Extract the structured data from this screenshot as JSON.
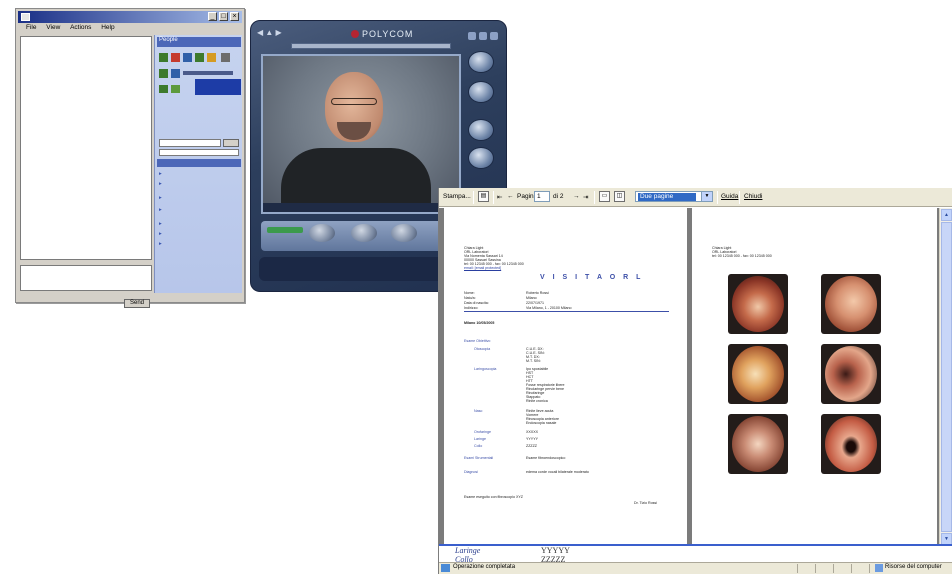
{
  "messenger": {
    "title": "",
    "menu": [
      "File",
      "View",
      "Actions",
      "Help"
    ],
    "panel_header": "People",
    "send_label": "Send",
    "status_text": "",
    "tasks": [
      "",
      "",
      "",
      "",
      "",
      "",
      ""
    ]
  },
  "polycom": {
    "brand": "POLYCOM",
    "caption": "",
    "right_labels": [
      "",
      "",
      "",
      "",
      ""
    ],
    "bottom_labels": [
      "",
      "",
      ""
    ]
  },
  "toolbar": {
    "print_label": "Stampa...",
    "page_label": "Pagina",
    "page_value": "1",
    "page_of": "di 2",
    "zoom_value": "Due pagine",
    "help_label": "Guida",
    "close_label": "Chiudi"
  },
  "page1": {
    "header_lines": [
      "Chiara Light",
      "ORL Laboratori",
      "Via Nomenta Sassari 14",
      "00000 Sassari Sassina",
      "tel: 00 12345 000 - fax: 00 12345 000",
      "email: [email protected]"
    ],
    "title": "V I S I T A   O R L",
    "patient_labels": [
      "Nome:",
      "Nato/a:",
      "Data di nascita:",
      "Indirizzo:"
    ],
    "patient_values": [
      "Roberto Rossi",
      "Milano",
      "22/07/1971",
      "Via Milano, 1 - 20100 Milano"
    ],
    "place_date": "Milano 10/05/2005",
    "sections": {
      "objective": "Esame Obiettivo",
      "otoscopy": "Otoscopia",
      "otoscopy_values": [
        "C.U.E. DX:",
        "C.U.E. SIN:",
        "M.T. DX:",
        "M.T. SIN:"
      ],
      "endoscopy": "Laringoscopia",
      "endoscopy_values": [
        "Ipo spostabile",
        "HST",
        "HCT",
        "HTT",
        "Fosse respiratorie libere",
        "Rinolaringe pervie bene",
        "Rinofaringe",
        "Stappato",
        "Rinite cronica"
      ],
      "nose": "Naso",
      "nose_values": [
        "Rinite lieve acuta",
        "Vomere",
        "Rinoscopia anteriore",
        "Endoscopia nasale"
      ],
      "orofaringe": "Orofaringe",
      "orofaringe_value": "XXXXX",
      "laringe": "Laringe",
      "laringe_value": "YYYYY",
      "collo": "Collo",
      "collo_value": "ZZZZZ",
      "instrumental": "Esami Strumentali",
      "instrumental_value": "Esame fibroendoscopico",
      "diagnosis": "Diagnosi",
      "diagnosis_value": "edema corde vocali bilaterale moderato"
    },
    "footer_note": "Esame eseguito con fibroscopio XYZ",
    "signature": "Dr. Tizio Rossi"
  },
  "page2": {
    "header_lines": [
      "Chiara Light",
      "ORL Laboratori",
      "tel: 00 12345 000 - fax: 00 12345 000"
    ]
  },
  "under_labels": {
    "laringe": "Laringe",
    "laringe_value": "YYYYY",
    "collo": "Collo",
    "collo_value": "ZZZZZ"
  },
  "statusbar": {
    "left": "Operazione completata",
    "right": "Risorse del computer"
  }
}
